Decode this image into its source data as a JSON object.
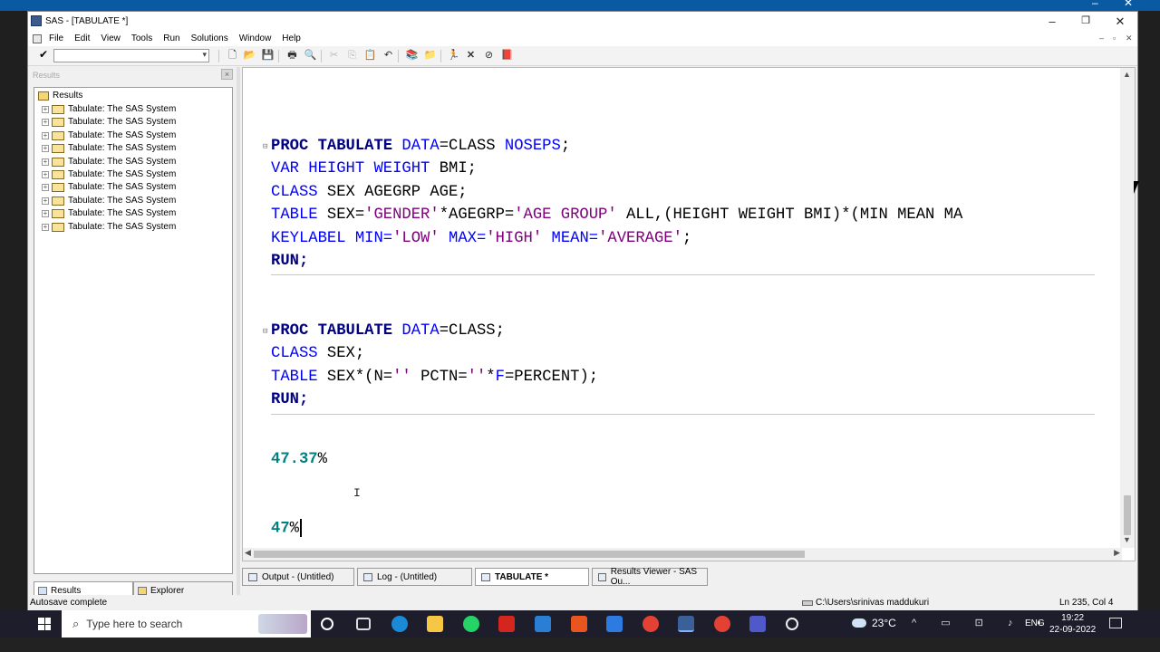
{
  "browser_strip": {
    "text": "...",
    "close_glyph": "✕"
  },
  "window": {
    "title": "SAS - [TABULATE *]",
    "controls": {
      "minimize": "–",
      "restore": "❐",
      "close": "✕"
    },
    "mdi_controls": {
      "minimize": "–",
      "restore": "▫",
      "close": "✕"
    }
  },
  "menu": [
    "File",
    "Edit",
    "View",
    "Tools",
    "Run",
    "Solutions",
    "Window",
    "Help"
  ],
  "toolbar": {
    "command_value": "",
    "icons": [
      "check-icon",
      "new-icon",
      "open-icon",
      "save-icon",
      "print-icon",
      "print-preview-icon",
      "cut-icon",
      "copy-icon",
      "paste-icon",
      "undo-icon",
      "libraries-icon",
      "explorer-icon",
      "run-icon",
      "clear-icon",
      "break-icon",
      "help-icon"
    ]
  },
  "results_pane": {
    "header": "Results",
    "root_label": "Results",
    "items": [
      "Tabulate:  The SAS System",
      "Tabulate:  The SAS System",
      "Tabulate:  The SAS System",
      "Tabulate:  The SAS System",
      "Tabulate:  The SAS System",
      "Tabulate:  The SAS System",
      "Tabulate:  The SAS System",
      "Tabulate:  The SAS System",
      "Tabulate:  The SAS System",
      "Tabulate:  The SAS System"
    ],
    "tabs": [
      "Results",
      "Explorer"
    ]
  },
  "editor": {
    "block1": {
      "l1": {
        "kw": "PROC TABULATE",
        "opt": "DATA",
        "eq": "=",
        "ds": "CLASS",
        "opt2": "NOSEPS",
        "end": ";"
      },
      "l2": {
        "kw": "VAR",
        "vars": "HEIGHT WEIGHT",
        "rest": "BMI;"
      },
      "l3": {
        "kw": "CLASS",
        "rest": "SEX AGEGRP AGE;"
      },
      "l4": {
        "kw": "TABLE",
        "a": "SEX=",
        "s1": "'GENDER'",
        "b": "*AGEGRP=",
        "s2": "'AGE GROUP'",
        "c": " ALL,(HEIGHT WEIGHT BMI)*(MIN MEAN MA"
      },
      "l5": {
        "kw": "KEYLABEL",
        "a": "MIN=",
        "s1": "'LOW'",
        "b": "MAX=",
        "s2": "'HIGH'",
        "c": "MEAN=",
        "s3": "'AVERAGE'",
        "end": ";"
      },
      "l6": {
        "kw": "RUN;"
      }
    },
    "block2": {
      "l1": {
        "kw": "PROC TABULATE",
        "opt": "DATA",
        "eq": "=",
        "ds": "CLASS;"
      },
      "l2": {
        "kw": "CLASS",
        "rest": "SEX;"
      },
      "l3": {
        "kw": "TABLE",
        "a": "SEX*(N=",
        "s1": "''",
        "b": " PCTN=",
        "s2": "''",
        "c": "*",
        "f": "F",
        "d": "=PERCENT);"
      },
      "l4": {
        "kw": "RUN;"
      }
    },
    "output1": {
      "num": "47.37",
      "pct": "%"
    },
    "output2": {
      "num": "47",
      "pct": "%"
    }
  },
  "window_tabs": [
    "Output - (Untitled)",
    "Log - (Untitled)",
    "TABULATE *",
    "Results Viewer - SAS Ou..."
  ],
  "status": {
    "left": "Autosave complete",
    "path": "C:\\Users\\srinivas maddukuri",
    "position": "Ln 235, Col 4"
  },
  "taskbar": {
    "search_placeholder": "Type here to search",
    "weather": "23°C",
    "lang": "ENG",
    "time": "19:22",
    "date": "22-09-2022"
  },
  "colors": {
    "keyword_bold": "#000080",
    "keyword": "#0000ff",
    "string": "#800080",
    "output": "#008080",
    "accent": "#0a5aa3"
  }
}
